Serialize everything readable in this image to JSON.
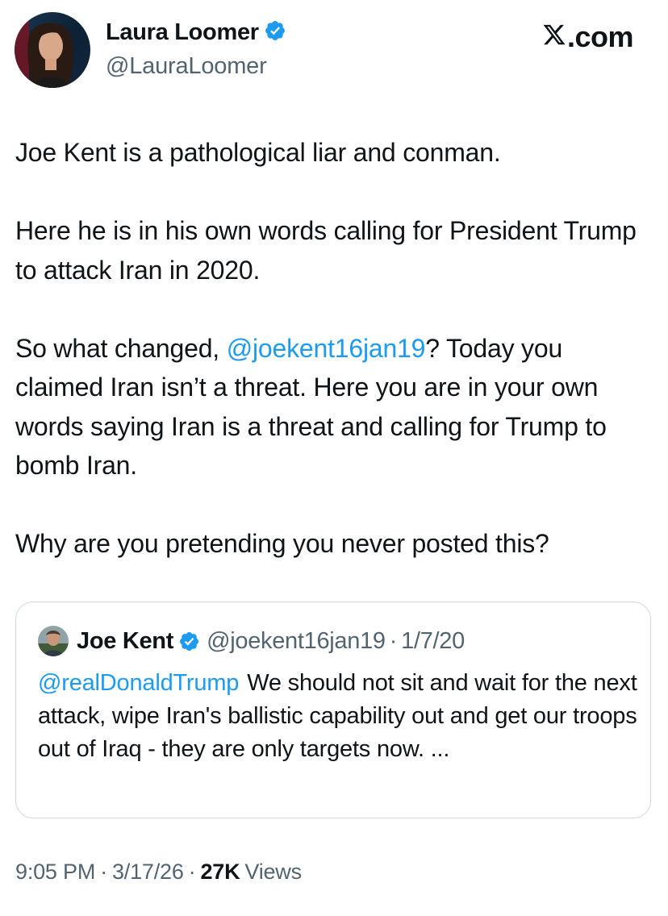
{
  "author": {
    "name": "Laura Loomer",
    "handle": "@LauraLoomer",
    "avatar_icon": "profile-photo",
    "verified_icon": "verified-badge-icon"
  },
  "site": {
    "logo_suffix": ".com",
    "logo_icon": "x-logo-icon"
  },
  "tweet": {
    "p1": "Joe Kent is a pathological liar and conman.",
    "p2": "Here he is in his own words calling for President Trump to attack Iran in 2020.",
    "p3_before": "So what changed, ",
    "p3_mention": "@joekent16jan19",
    "p3_after": "? Today you claimed Iran isn’t a threat. Here you are in your own words saying Iran is a threat and calling for Trump to bomb Iran.",
    "p4": "Why are you pretending you never posted this?"
  },
  "quoted": {
    "name": "Joe Kent",
    "handle": "@joekent16jan19",
    "separator": "·",
    "date": "1/7/20",
    "mention": "@realDonaldTrump",
    "text": "We should not sit and wait for the next attack, wipe Iran's ballistic capability out and get our troops out of Iraq - they are only targets now. ..."
  },
  "meta": {
    "time": "9:05 PM",
    "separator": "·",
    "date": "3/17/26",
    "views_count": "27K",
    "views_label": "Views"
  },
  "colors": {
    "link": "#1d9bf0",
    "secondary_text": "#536471",
    "border": "#cfd9de"
  }
}
